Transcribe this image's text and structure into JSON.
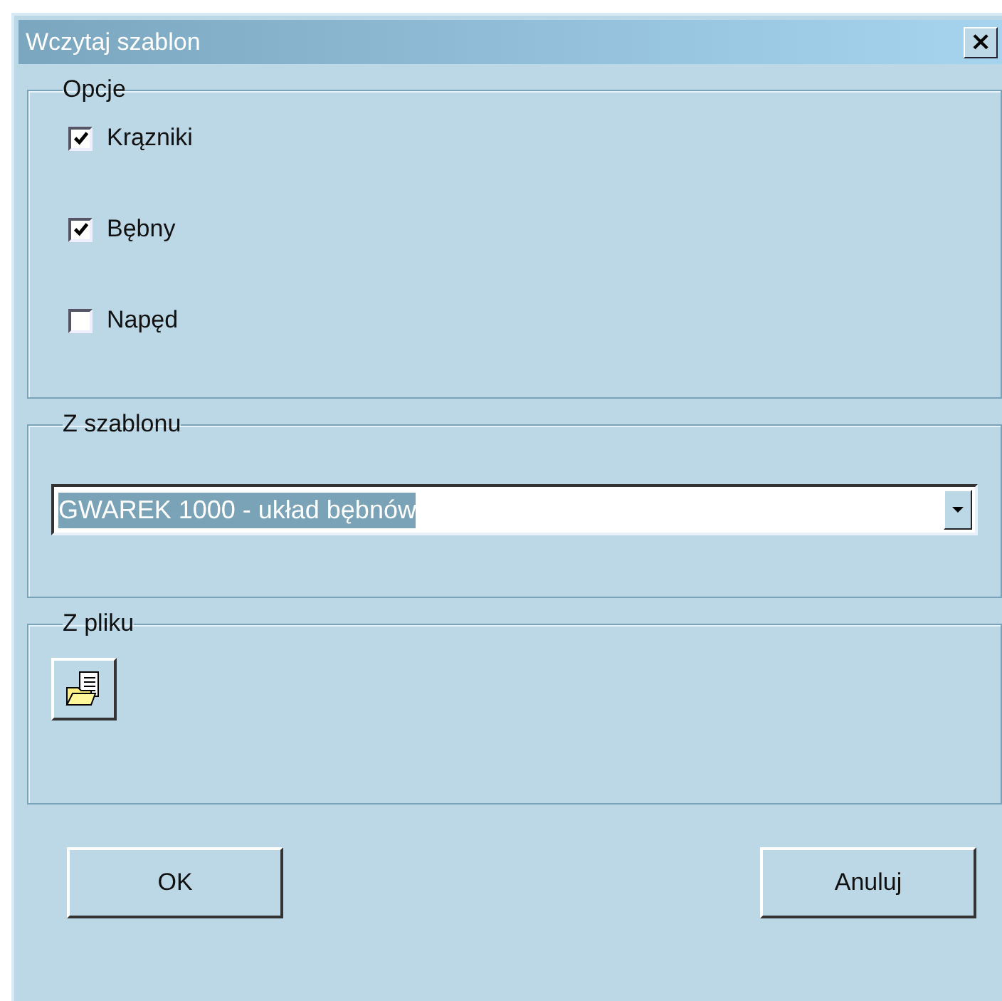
{
  "window": {
    "title": "Wczytaj szablon",
    "close": "×"
  },
  "options_group": {
    "title": "Opcje",
    "checkboxes": [
      {
        "label": "Krązniki",
        "checked": true
      },
      {
        "label": "Bębny",
        "checked": true
      },
      {
        "label": "Napęd",
        "checked": false
      }
    ]
  },
  "template_group": {
    "title": "Z szablonu",
    "combobox": {
      "value": "GWAREK 1000 - układ bębnów"
    }
  },
  "file_group": {
    "title": "Z pliku"
  },
  "buttons": [
    "OK",
    "Anuluj"
  ]
}
